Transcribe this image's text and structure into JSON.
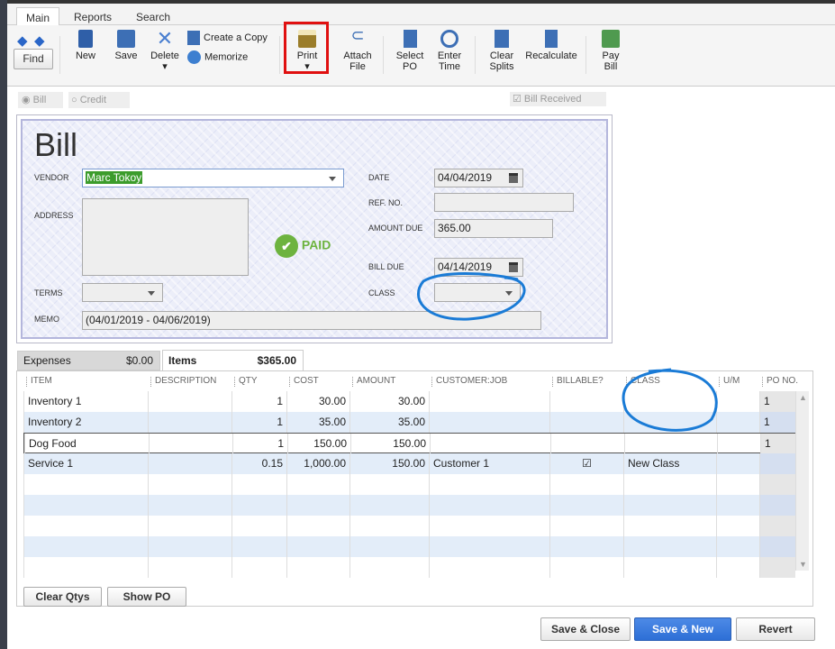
{
  "tabs": [
    {
      "label": "Main"
    },
    {
      "label": "Reports"
    },
    {
      "label": "Search"
    }
  ],
  "toolbar": {
    "find": "Find",
    "new": "New",
    "save": "Save",
    "delete": "Delete",
    "create_copy": "Create a Copy",
    "memorize": "Memorize",
    "print": "Print",
    "attach_1": "Attach",
    "attach_2": "File",
    "select_1": "Select",
    "select_2": "PO",
    "enter_1": "Enter",
    "enter_2": "Time",
    "clear_1": "Clear",
    "clear_2": "Splits",
    "recalculate": "Recalculate",
    "pay_1": "Pay",
    "pay_2": "Bill"
  },
  "mode": {
    "bill": "Bill",
    "credit": "Credit",
    "bill_received": "Bill Received"
  },
  "form": {
    "title": "Bill",
    "vendor_label": "VENDOR",
    "vendor": "Marc Tokoy",
    "address_label": "ADDRESS",
    "terms_label": "TERMS",
    "memo_label": "MEMO",
    "memo": "(04/01/2019 - 04/06/2019)",
    "date_label": "DATE",
    "date": "04/04/2019",
    "ref_label": "REF. NO.",
    "amount_due_label": "AMOUNT DUE",
    "amount_due": "365.00",
    "bill_due_label": "BILL DUE",
    "bill_due": "04/14/2019",
    "class_label": "CLASS",
    "paid": "PAID"
  },
  "detail_tabs": {
    "expenses": "Expenses",
    "expenses_amt": "$0.00",
    "items": "Items",
    "items_amt": "$365.00"
  },
  "columns": [
    "ITEM",
    "DESCRIPTION",
    "QTY",
    "COST",
    "AMOUNT",
    "CUSTOMER:JOB",
    "BILLABLE?",
    "CLASS",
    "U/M",
    "PO NO."
  ],
  "rows": [
    {
      "item": "Inventory 1",
      "desc": "",
      "qty": "1",
      "cost": "30.00",
      "amount": "30.00",
      "customer": "",
      "billable": false,
      "class": "",
      "um": "",
      "po": "1"
    },
    {
      "item": "Inventory 2",
      "desc": "",
      "qty": "1",
      "cost": "35.00",
      "amount": "35.00",
      "customer": "",
      "billable": false,
      "class": "",
      "um": "",
      "po": "1"
    },
    {
      "item": "Dog Food",
      "desc": "",
      "qty": "1",
      "cost": "150.00",
      "amount": "150.00",
      "customer": "",
      "billable": false,
      "class": "",
      "um": "",
      "po": "1"
    },
    {
      "item": "Service 1",
      "desc": "",
      "qty": "0.15",
      "cost": "1,000.00",
      "amount": "150.00",
      "customer": "Customer 1",
      "billable": true,
      "class": "New Class",
      "um": "",
      "po": ""
    }
  ],
  "buttons": {
    "clear_qtys": "Clear Qtys",
    "show_po": "Show PO",
    "save_close": "Save & Close",
    "save_new": "Save & New",
    "revert": "Revert"
  },
  "colors": {
    "accent": "#2d6fd6",
    "annotation_blue": "#1a7bd6",
    "annotation_red": "#e01010",
    "paid_green": "#6db33f"
  }
}
